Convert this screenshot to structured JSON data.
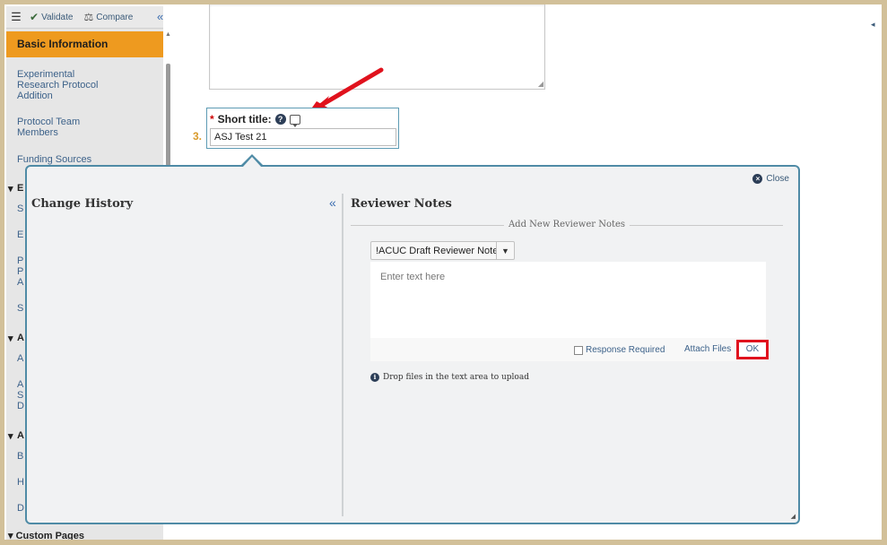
{
  "toolbar": {
    "validate_label": "Validate",
    "compare_label": "Compare"
  },
  "sidebar": {
    "active_item": "Basic Information",
    "items": [
      "Experimental Research Protocol Addition",
      "Protocol Team Members",
      "Funding Sources"
    ],
    "truncated_items": [
      "E",
      "S",
      "E",
      "P",
      "P",
      "A",
      "S",
      "A",
      "A",
      "A",
      "S",
      "D",
      "A",
      "B",
      "H",
      "D"
    ],
    "custom_pages": "Custom Pages"
  },
  "form": {
    "short_title_label": "Short title:",
    "short_title_value": "ASJ Test 21",
    "step_number": "3."
  },
  "popup": {
    "close_label": "Close",
    "change_history_title": "Change History",
    "reviewer_notes_title": "Reviewer Notes",
    "add_new_label": "Add New Reviewer Notes",
    "note_type_value": "!ACUC Draft Reviewer Note",
    "editor_placeholder": "Enter text here",
    "response_required_label": "Response Required",
    "attach_files_label": "Attach Files",
    "ok_label": "OK",
    "drop_files_text": "Drop files in the text area to upload"
  },
  "colors": {
    "accent": "#ee9a1f",
    "popup_border": "#4f8ba6",
    "annotation_red": "#e0121d",
    "link_blue": "#3d628a"
  }
}
